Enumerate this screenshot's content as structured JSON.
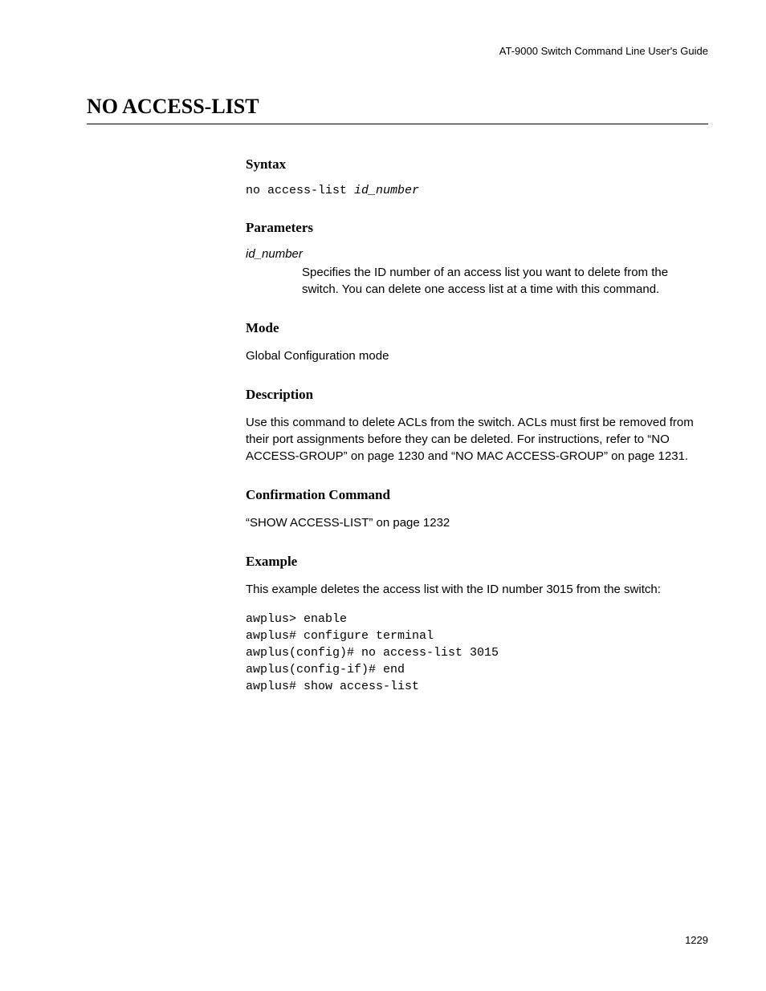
{
  "header": {
    "doc_title": "AT-9000 Switch Command Line User's Guide"
  },
  "page_title": "NO ACCESS-LIST",
  "sections": {
    "syntax": {
      "heading": "Syntax",
      "cmd_prefix": "no access-list ",
      "cmd_arg": "id_number"
    },
    "parameters": {
      "heading": "Parameters",
      "param_name": "id_number",
      "param_desc": "Specifies the ID number of an access list you want to delete from the switch. You can delete one access list at a time with this command."
    },
    "mode": {
      "heading": "Mode",
      "text": "Global Configuration mode"
    },
    "description": {
      "heading": "Description",
      "text": "Use this command to delete ACLs from the switch. ACLs must first be removed from their port assignments before they can be deleted. For instructions, refer to “NO ACCESS-GROUP” on page 1230 and “NO MAC ACCESS-GROUP” on page 1231."
    },
    "confirmation": {
      "heading": "Confirmation Command",
      "text": "“SHOW ACCESS-LIST” on page 1232"
    },
    "example": {
      "heading": "Example",
      "intro": "This example deletes the access list with the ID number 3015 from the switch:",
      "code": "awplus> enable\nawplus# configure terminal\nawplus(config)# no access-list 3015\nawplus(config-if)# end\nawplus# show access-list"
    }
  },
  "page_number": "1229"
}
